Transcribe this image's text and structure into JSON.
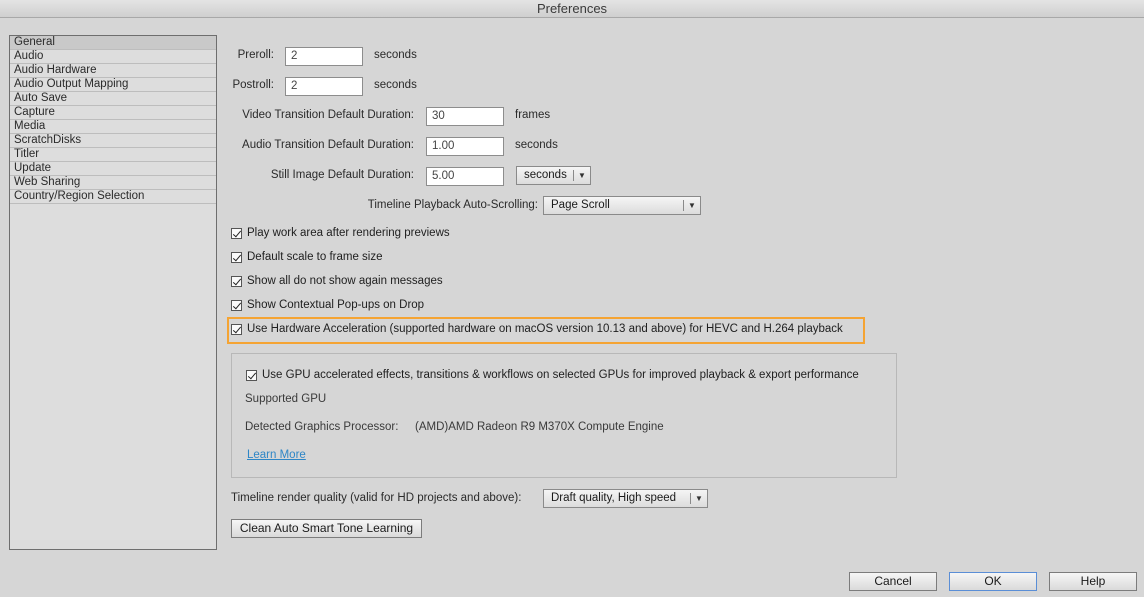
{
  "window": {
    "title": "Preferences"
  },
  "sidebar": {
    "items": [
      {
        "label": "General",
        "selected": true
      },
      {
        "label": "Audio"
      },
      {
        "label": "Audio Hardware"
      },
      {
        "label": "Audio Output Mapping"
      },
      {
        "label": "Auto Save"
      },
      {
        "label": "Capture"
      },
      {
        "label": "Media"
      },
      {
        "label": "ScratchDisks"
      },
      {
        "label": "Titler"
      },
      {
        "label": "Update"
      },
      {
        "label": "Web Sharing"
      },
      {
        "label": "Country/Region Selection"
      }
    ]
  },
  "general": {
    "preroll": {
      "label": "Preroll:",
      "value": "2",
      "unit": "seconds"
    },
    "postroll": {
      "label": "Postroll:",
      "value": "2",
      "unit": "seconds"
    },
    "video_transition": {
      "label": "Video Transition Default Duration:",
      "value": "30",
      "unit": "frames"
    },
    "audio_transition": {
      "label": "Audio Transition Default Duration:",
      "value": "1.00",
      "unit": "seconds"
    },
    "still_image": {
      "label": "Still Image Default Duration:",
      "value": "5.00",
      "unit_dropdown": "seconds"
    },
    "auto_scrolling": {
      "label": "Timeline Playback Auto-Scrolling:",
      "value": "Page Scroll"
    },
    "checkboxes": [
      {
        "label": "Play work area after rendering previews",
        "checked": true
      },
      {
        "label": "Default scale to frame size",
        "checked": true
      },
      {
        "label": "Show all do not show again messages",
        "checked": true
      },
      {
        "label": "Show Contextual Pop-ups on Drop",
        "checked": true
      },
      {
        "label": "Use Hardware Acceleration (supported hardware on macOS version 10.13 and above) for HEVC and H.264 playback",
        "checked": true
      }
    ],
    "gpu": {
      "checkbox_label": "Use GPU accelerated effects, transitions & workflows on selected GPUs for improved playback & export performance",
      "checked": true,
      "supported_label": "Supported GPU",
      "detected_label": "Detected Graphics Processor:",
      "detected_value": "(AMD)AMD Radeon R9 M370X Compute Engine",
      "learn_more": "Learn More"
    },
    "render_quality": {
      "label": "Timeline render quality (valid for HD projects and above):",
      "value": "Draft quality, High speed"
    },
    "clean_button": "Clean Auto Smart Tone Learning"
  },
  "footer": {
    "cancel": "Cancel",
    "ok": "OK",
    "help": "Help"
  },
  "colors": {
    "highlight": "#f5a433",
    "link": "#2e86c6"
  }
}
